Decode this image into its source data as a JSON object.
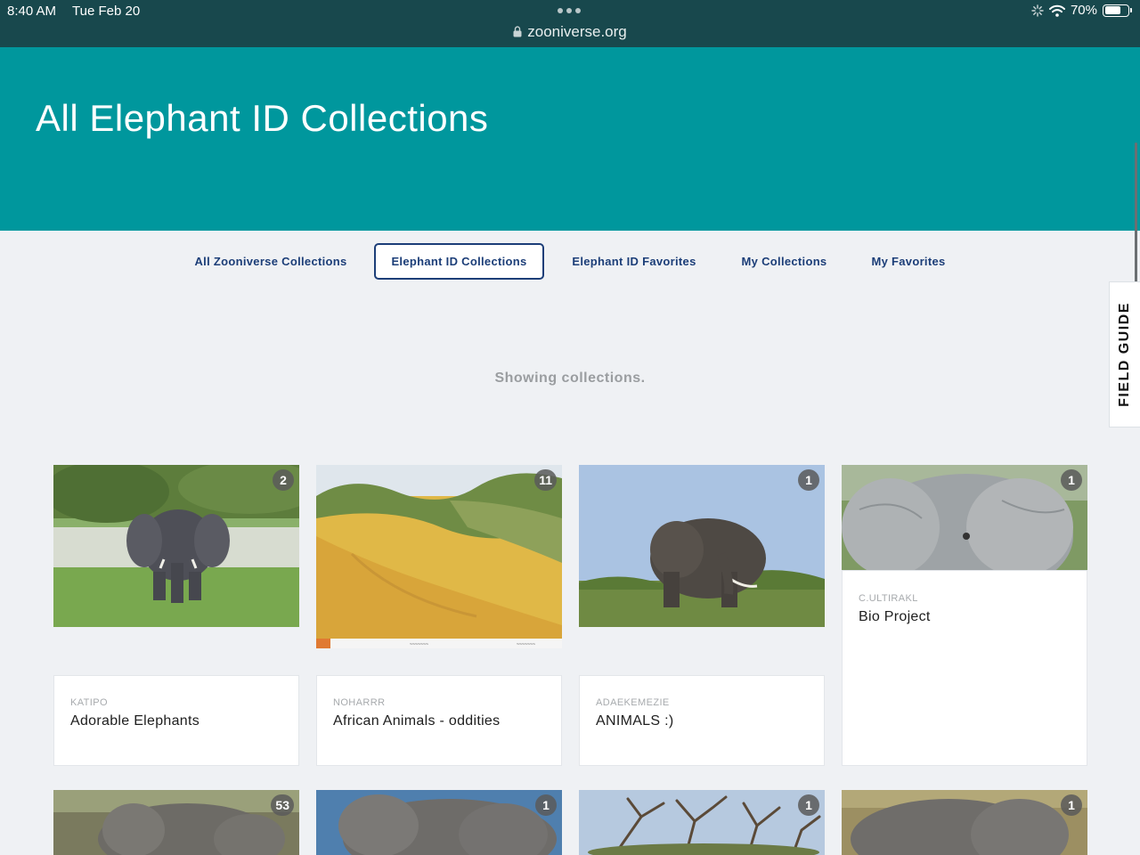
{
  "status_bar": {
    "time": "8:40 AM",
    "date": "Tue Feb 20",
    "url": "zooniverse.org",
    "battery": "70%",
    "battery_level": 0.7
  },
  "hero": {
    "title": "All Elephant ID Collections"
  },
  "tabs": [
    {
      "label": "All Zooniverse Collections",
      "active": false
    },
    {
      "label": "Elephant ID Collections",
      "active": true
    },
    {
      "label": "Elephant ID Favorites",
      "active": false
    },
    {
      "label": "My Collections",
      "active": false
    },
    {
      "label": "My Favorites",
      "active": false
    }
  ],
  "field_guide_label": "FIELD GUIDE",
  "status_message": "Showing collections.",
  "collections": [
    {
      "owner": "KATIPO",
      "title": "Adorable Elephants",
      "count": "2"
    },
    {
      "owner": "NOHARRR",
      "title": "African Animals - oddities",
      "count": "11"
    },
    {
      "owner": "ADAEKEMEZIE",
      "title": "ANIMALS :)",
      "count": "1"
    },
    {
      "owner": "C.ULTIRAKL",
      "title": "Bio Project",
      "count": "1"
    },
    {
      "owner": "",
      "title": "",
      "count": "53"
    },
    {
      "owner": "",
      "title": "",
      "count": "1"
    },
    {
      "owner": "",
      "title": "",
      "count": "1"
    },
    {
      "owner": "",
      "title": "",
      "count": "1"
    }
  ],
  "colors": {
    "status_bar": "#18484d",
    "hero": "#00979d",
    "tab_text": "#1c3e78",
    "page_bg": "#eff1f4"
  }
}
